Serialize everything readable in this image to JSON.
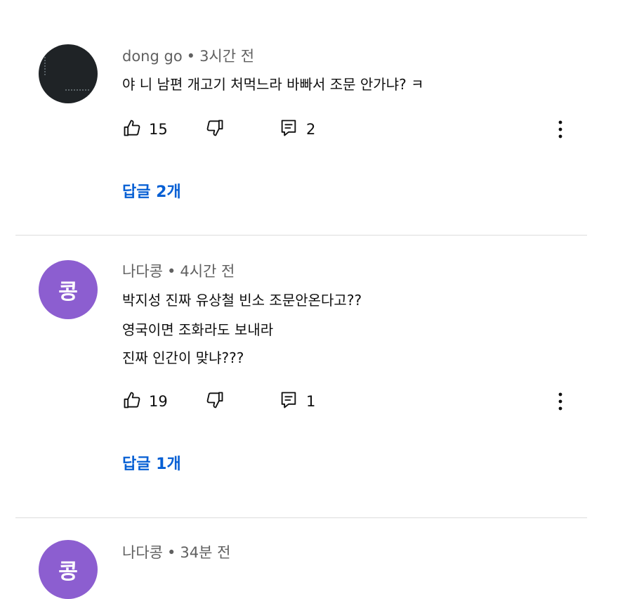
{
  "comments": [
    {
      "author": "dong go",
      "time": "3시간 전",
      "avatar_kind": "photo",
      "lines": [
        "야 니 남편 개고기 처먹느라 바빠서 조문 안가냐? ㅋ"
      ],
      "likes": "15",
      "reply_count": "2",
      "replies_label": "답글 2개"
    },
    {
      "author": "나다콩",
      "time": "4시간 전",
      "avatar_kind": "letter",
      "avatar_letter": "콩",
      "avatar_color": "#8c5ed0",
      "lines": [
        "박지성 진짜 유상철 빈소 조문안온다고??",
        "영국이면 조화라도 보내라",
        "진짜 인간이 맞냐???"
      ],
      "likes": "19",
      "reply_count": "1",
      "replies_label": "답글 1개"
    },
    {
      "author": "나다콩",
      "time": "34분 전",
      "avatar_kind": "letter",
      "avatar_letter": "콩",
      "avatar_color": "#8c5ed0"
    }
  ],
  "separator": "•",
  "icons": {
    "like": "thumbs-up-icon",
    "dislike": "thumbs-down-icon",
    "reply": "comment-icon",
    "more": "more-vert-icon"
  },
  "colors": {
    "link": "#065fd4",
    "meta_text": "#606060",
    "avatar_purple": "#8c5ed0"
  }
}
